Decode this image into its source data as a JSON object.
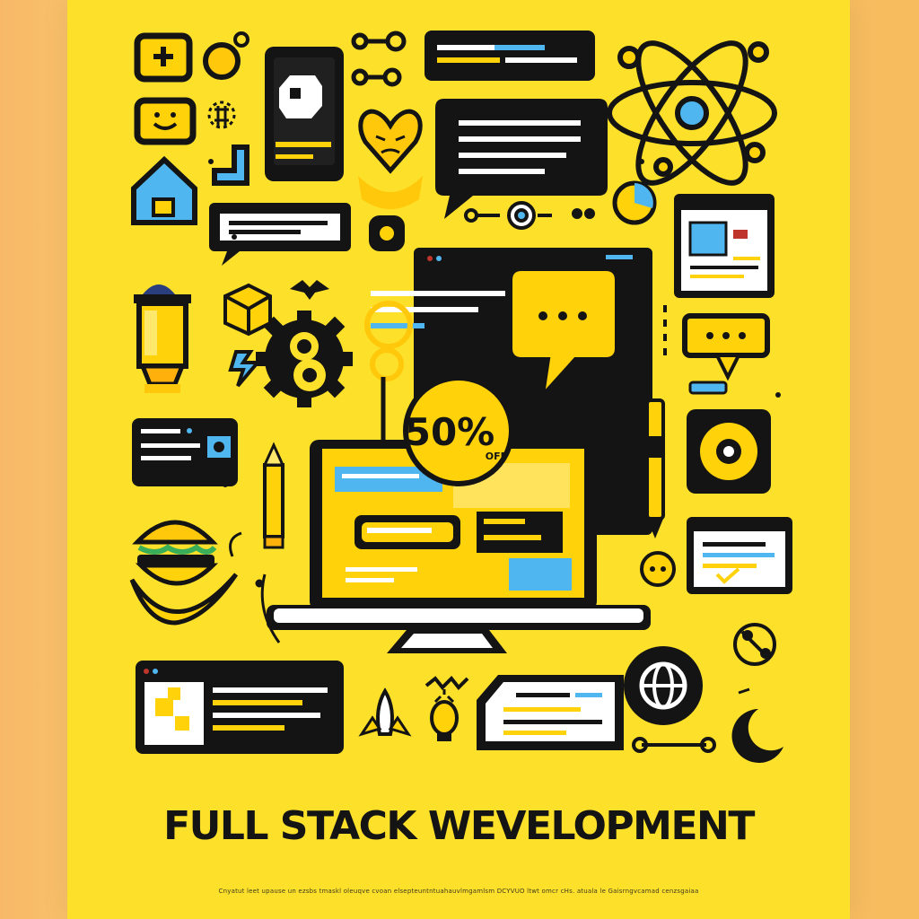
{
  "poster": {
    "title": "FULL STACK WEVELOPMENT",
    "badge": {
      "value": "50%",
      "label": "OFF"
    },
    "fine_print": "Cnyatut leet upause un ezsbs tmaskl oleuqve cvoan elsepteuntntuahauvlmgamlsm DCYVUO ltwt omcr cHs. atuala le Gaisrngvcamad cenzsgaiaa"
  },
  "colors": {
    "background": "#fde02a",
    "ink": "#141414",
    "accent_blue": "#4fb6ef",
    "accent_yellow": "#ffd20a",
    "page_edge": "#f7b968"
  },
  "icons": [
    "plus-tile-icon",
    "gear-icon",
    "phone-icon",
    "link-nodes-icon",
    "chat-bar-icon",
    "atom-icon",
    "smiley-tile-icon",
    "heart-character-icon",
    "speech-bubble-icon",
    "house-icon",
    "message-banner-icon",
    "browser-window-icon",
    "lantern-icon",
    "cube-icon",
    "cog-icon",
    "laptop-icon",
    "discount-badge-icon",
    "chat-dots-icon",
    "pencil-icon",
    "burger-icon",
    "video-player-icon",
    "code-window-icon",
    "globe-icon",
    "moon-icon",
    "rocket-icon",
    "lightbulb-icon",
    "document-icon"
  ]
}
